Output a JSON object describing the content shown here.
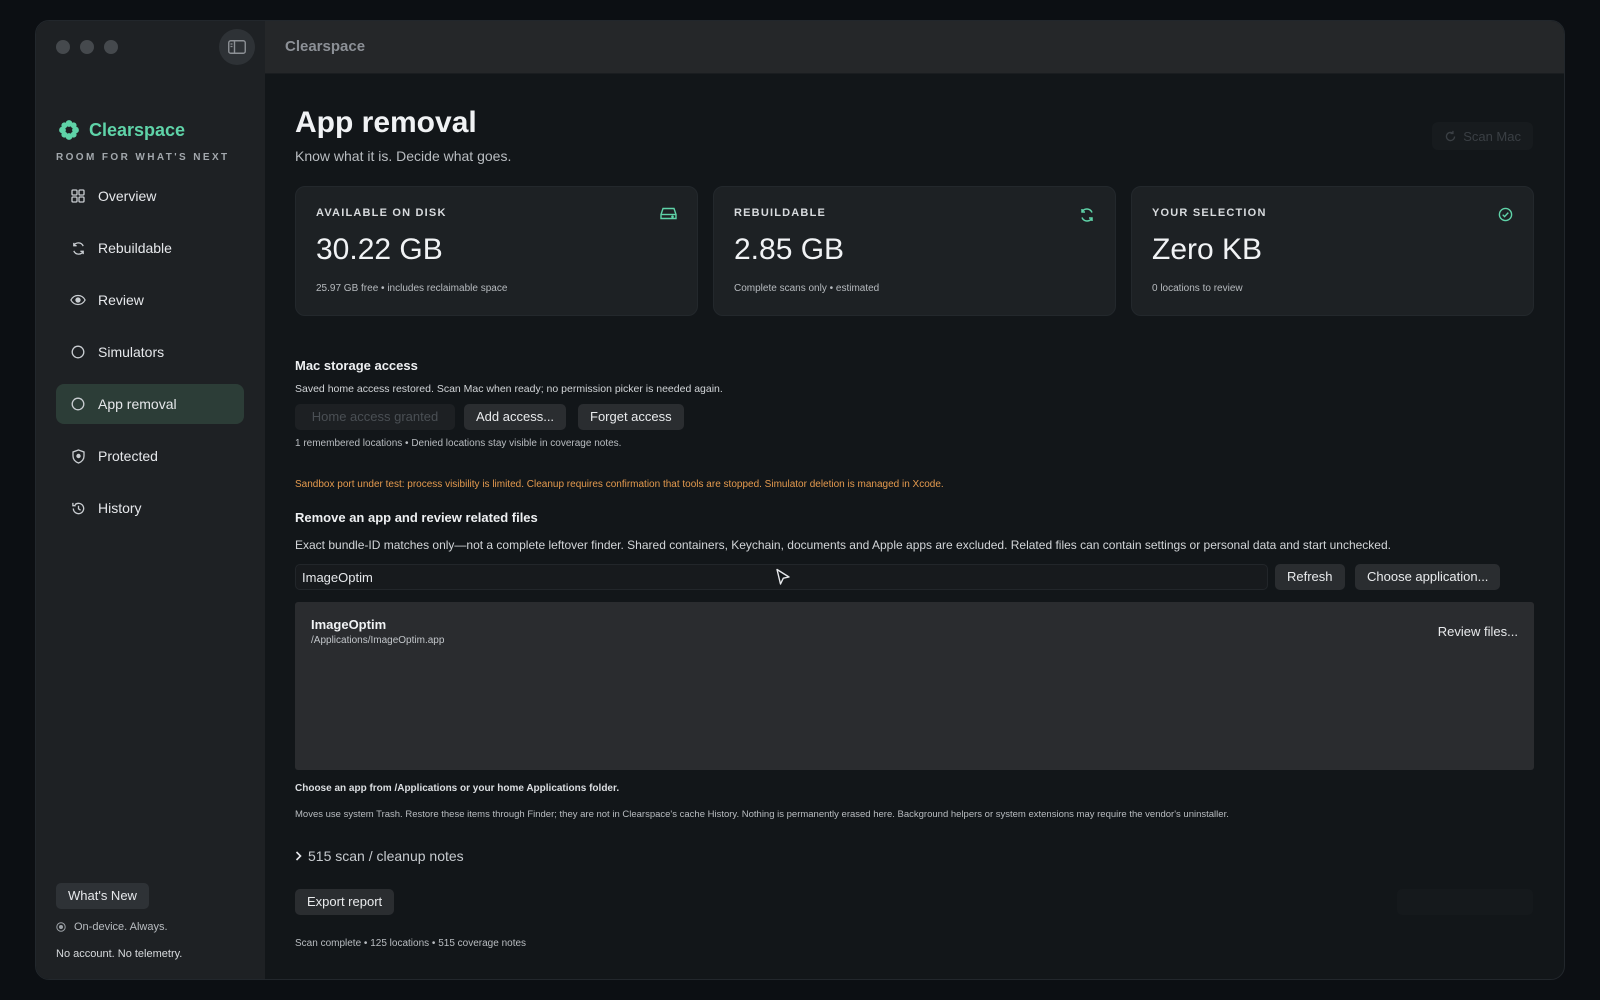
{
  "window": {
    "title": "Clearspace"
  },
  "sidebar": {
    "brand": "Clearspace",
    "tagline": "ROOM FOR WHAT'S NEXT",
    "items": [
      {
        "label": "Overview",
        "icon": "grid-icon"
      },
      {
        "label": "Rebuildable",
        "icon": "refresh-icon"
      },
      {
        "label": "Review",
        "icon": "eye-icon"
      },
      {
        "label": "Simulators",
        "icon": "circle-icon"
      },
      {
        "label": "App removal",
        "icon": "circle-icon",
        "active": true
      },
      {
        "label": "Protected",
        "icon": "shield-icon"
      },
      {
        "label": "History",
        "icon": "history-icon"
      }
    ],
    "whats_new": "What's New",
    "on_device": "On-device. Always.",
    "no_account": "No account. No telemetry."
  },
  "main": {
    "title": "App removal",
    "subtitle": "Know what it is. Decide what goes.",
    "scan_mac": "Scan Mac",
    "cards": [
      {
        "label": "AVAILABLE ON DISK",
        "value": "30.22 GB",
        "note": "25.97 GB free • includes reclaimable space",
        "icon": "drive-icon"
      },
      {
        "label": "REBUILDABLE",
        "value": "2.85 GB",
        "note": "Complete scans only • estimated",
        "icon": "refresh-icon"
      },
      {
        "label": "YOUR SELECTION",
        "value": "Zero KB",
        "note": "0 locations to review",
        "icon": "check-circle-icon"
      }
    ],
    "storage": {
      "title": "Mac storage access",
      "description": "Saved home access restored. Scan Mac when ready; no permission picker is needed again.",
      "home_access": "Home access granted",
      "add_access": "Add access...",
      "forget_access": "Forget access",
      "remembered": "1 remembered locations • Denied locations stay visible in coverage notes."
    },
    "warning": "Sandbox port under test: process visibility is limited. Cleanup requires confirmation that tools are stopped. Simulator deletion is managed in Xcode.",
    "remove": {
      "title": "Remove an app and review related files",
      "description": "Exact bundle-ID matches only—not a complete leftover finder. Shared containers, Keychain, documents and Apple apps are excluded. Related files can contain settings or personal data and start unchecked.",
      "input_value": "ImageOptim",
      "refresh": "Refresh",
      "choose": "Choose application...",
      "app_name": "ImageOptim",
      "app_path": "/Applications/ImageOptim.app",
      "review_files": "Review files...",
      "hint": "Choose an app from /Applications or your home Applications folder.",
      "trash_note": "Moves use system Trash. Restore these items through Finder; they are not in Clearspace's cache History. Nothing is permanently erased here. Background helpers or system extensions may require the vendor's uninstaller."
    },
    "notes_toggle": "515 scan / cleanup notes",
    "export_report": "Export report",
    "status": "Scan complete • 125 locations • 515 coverage notes"
  },
  "colors": {
    "accent": "#5fd3a8",
    "warning": "#e49a4e",
    "active_nav": "#2c3d37"
  }
}
